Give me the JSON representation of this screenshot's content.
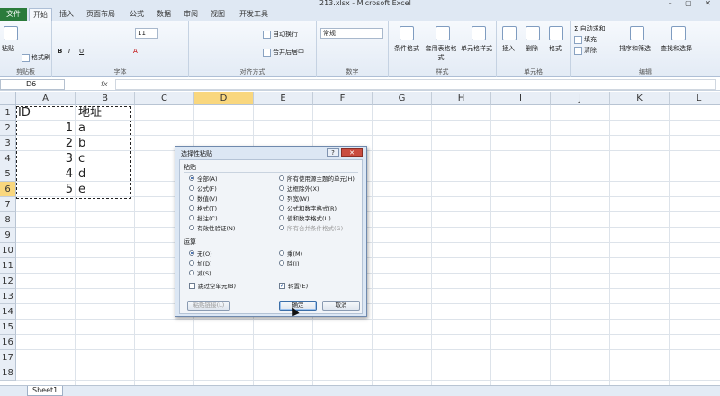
{
  "window": {
    "title": "213.xlsx - Microsoft Excel",
    "controls": "– ▢ ✕"
  },
  "tabs": [
    {
      "label": "文件"
    },
    {
      "label": "开始"
    },
    {
      "label": "插入"
    },
    {
      "label": "页面布局"
    },
    {
      "label": "公式"
    },
    {
      "label": "数据"
    },
    {
      "label": "审阅"
    },
    {
      "label": "视图"
    },
    {
      "label": "开发工具"
    }
  ],
  "ribbon": {
    "clipboard": {
      "paste": "粘贴",
      "format_painter": "格式刷",
      "label": "剪贴板"
    },
    "font": {
      "size": "11",
      "label": "字体"
    },
    "alignment": {
      "wrap": "自动换行",
      "merge": "合并后居中",
      "label": "对齐方式"
    },
    "number": {
      "format": "常规",
      "label": "数字"
    },
    "styles": {
      "cond": "条件格式",
      "table": "套用表格格式",
      "cell": "单元格样式",
      "label": "样式"
    },
    "cells": {
      "insert": "插入",
      "delete": "删除",
      "format": "格式",
      "label": "单元格"
    },
    "editing": {
      "autosum": "自动求和",
      "fill": "填充",
      "clear": "清除",
      "sort": "排序和筛选",
      "find": "查找和选择",
      "label": "编辑"
    }
  },
  "formula_bar": {
    "name_box": "D6",
    "fx": "fx",
    "value": ""
  },
  "grid": {
    "columns": [
      "A",
      "B",
      "C",
      "D",
      "E",
      "F",
      "G",
      "H",
      "I",
      "J",
      "K",
      "L"
    ],
    "selected_column": "D",
    "rows": [
      "1",
      "2",
      "3",
      "4",
      "5",
      "6",
      "7",
      "8",
      "9",
      "10",
      "11",
      "12",
      "13",
      "14",
      "15",
      "16",
      "17",
      "18"
    ],
    "selected_row": "6",
    "cells": [
      {
        "a": "ID",
        "b": "地址"
      },
      {
        "a": "1",
        "b": "a"
      },
      {
        "a": "2",
        "b": "b"
      },
      {
        "a": "3",
        "b": "c"
      },
      {
        "a": "4",
        "b": "d"
      },
      {
        "a": "5",
        "b": "e"
      }
    ]
  },
  "sheet": {
    "tab": "Sheet1"
  },
  "dialog": {
    "title": "选择性粘贴",
    "help": "?",
    "close": "✕",
    "paste_label": "粘贴",
    "paste_options_left": [
      "全部(A)",
      "公式(F)",
      "数值(V)",
      "格式(T)",
      "批注(C)",
      "有效性验证(N)"
    ],
    "paste_options_right": [
      "所有使用源主题的单元(H)",
      "边框除外(X)",
      "列宽(W)",
      "公式和数字格式(R)",
      "值和数字格式(U)",
      "所有合并条件格式(G)"
    ],
    "operation_label": "运算",
    "operation_left": [
      "无(O)",
      "加(D)",
      "减(S)"
    ],
    "operation_right": [
      "乘(M)",
      "除(I)"
    ],
    "skip_blanks": "跳过空单元(B)",
    "transpose": "转置(E)",
    "paste_link": "粘贴链接(L)",
    "ok": "确定",
    "cancel": "取消"
  },
  "colors": {
    "file_tab": "#2a7b3b",
    "selection_header": "#f9d77e",
    "dialog_bg": "#dce7f4"
  }
}
